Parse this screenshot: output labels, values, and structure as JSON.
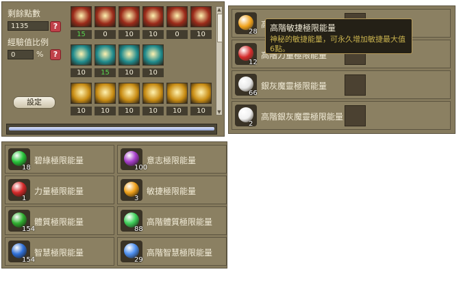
{
  "stat_panel": {
    "remaining_points_label": "剩餘點數",
    "remaining_points_value": "1135",
    "exp_ratio_label": "經驗值比例",
    "exp_ratio_value": "0",
    "exp_ratio_unit": "%",
    "help_glyph": "?",
    "settings_button": "設定"
  },
  "skill_rows": [
    [
      "15",
      "0",
      "10",
      "10",
      "0",
      "10"
    ],
    [
      "10",
      "15",
      "10",
      "10"
    ],
    [
      "10",
      "10",
      "10",
      "10",
      "10",
      "10"
    ]
  ],
  "skill_row_colors": [
    "#9b2b1a",
    "#1f8a8c",
    "#c98d14"
  ],
  "experience_bar": {
    "fill_fraction": 1.0
  },
  "energy_left": [
    {
      "label": "碧綠極限能量",
      "count": "18",
      "color": "#27c43a"
    },
    {
      "label": "意志極限能量",
      "count": "100",
      "color": "#a53cc9"
    },
    {
      "label": "力量極限能量",
      "count": "1",
      "color": "#d42a2a"
    },
    {
      "label": "敏捷極限能量",
      "count": "3",
      "color": "#f0a11a"
    },
    {
      "label": "體質極限能量",
      "count": "154",
      "color": "#2fae2f"
    },
    {
      "label": "高階體質極限能量",
      "count": "88",
      "color": "#3fd05a"
    },
    {
      "label": "智慧極限能量",
      "count": "154",
      "color": "#2f6fd6"
    },
    {
      "label": "高階智慧極限能量",
      "count": "29",
      "color": "#4d8ff0"
    }
  ],
  "energy_right": [
    {
      "label": "高階敏捷極限能量",
      "count": "28",
      "color": "#f0a11a"
    },
    {
      "label": "高階力量極限能量",
      "count": "12",
      "color": "#d42a2a"
    },
    {
      "label": "銀灰魔靈極限能量",
      "count": "66",
      "color": "#e8e8e8"
    },
    {
      "label": "高階銀灰魔靈極限能量",
      "count": "2",
      "color": "#f0f0f0"
    }
  ],
  "tooltip": {
    "title": "高階敏捷極限能量",
    "description": "神秘的敏捷能量，可永久增加敏捷最大值6點。"
  }
}
